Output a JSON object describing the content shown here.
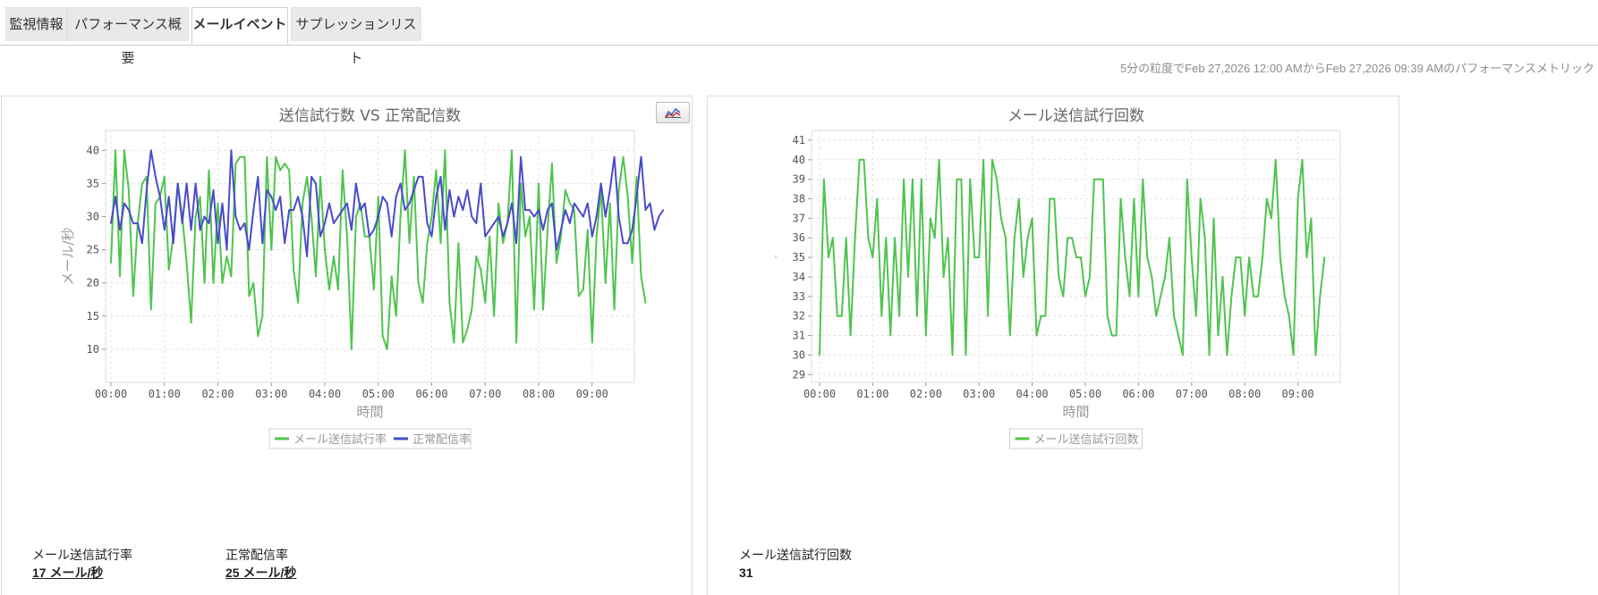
{
  "tabs": [
    {
      "label": "監視情報",
      "active": false
    },
    {
      "label": "パフォーマンス概要",
      "active": false
    },
    {
      "label": "メールイベント",
      "active": true
    },
    {
      "label": "サプレッションリスト",
      "active": false
    }
  ],
  "subtitle": "5分の粒度でFeb 27,2026 12:00 AMからFeb 27,2026 09:39 AMのパフォーマンスメトリック",
  "colors": {
    "green": "#4fc44f",
    "blue": "#4a4acc",
    "accent_text": "#8d8d8d"
  },
  "left_panel": {
    "chart_button_icon": "area-chart-icon",
    "metrics": [
      {
        "label": "メール送信試行率",
        "value": "17 メール/秒"
      },
      {
        "label": "正常配信率",
        "value": "25 メール/秒"
      }
    ]
  },
  "right_panel": {
    "metrics": [
      {
        "label": "メール送信試行回数",
        "value": "31"
      }
    ]
  },
  "chart_data": [
    {
      "type": "line",
      "title": "送信試行数 VS 正常配信数",
      "xlabel": "時間",
      "ylabel": "メール/秒",
      "ylim": [
        5,
        43
      ],
      "yticks": [
        10,
        15,
        20,
        25,
        30,
        35,
        40
      ],
      "xticks": [
        "00:00",
        "01:00",
        "02:00",
        "03:00",
        "04:00",
        "05:00",
        "06:00",
        "07:00",
        "08:00",
        "09:00"
      ],
      "x_interval_minutes": 5,
      "grid": true,
      "legend_position": "bottom-center",
      "series": [
        {
          "name": "メール送信試行率",
          "color": "#4fc44f",
          "values": [
            23,
            40,
            21,
            40,
            34,
            18,
            29,
            35,
            36,
            16,
            32,
            33,
            36,
            22,
            27,
            35,
            30,
            23,
            14,
            30,
            33,
            20,
            37,
            20,
            32,
            20,
            24,
            21,
            38,
            39,
            39,
            18,
            20,
            12,
            15,
            39,
            25,
            39,
            37,
            38,
            37,
            22,
            17,
            32,
            36,
            30,
            21,
            36,
            25,
            19,
            24,
            19,
            37,
            27,
            10,
            30,
            32,
            27,
            27,
            19,
            33,
            12,
            10,
            21,
            15,
            30,
            40,
            26,
            36,
            20,
            17,
            26,
            30,
            37,
            26,
            40,
            17,
            11,
            26,
            11,
            13,
            16,
            24,
            22,
            17,
            27,
            15,
            32,
            26,
            29,
            40,
            11,
            35,
            27,
            30,
            16,
            35,
            16,
            28,
            38,
            23,
            27,
            34,
            32,
            31,
            18,
            19,
            28,
            11,
            27,
            34,
            20,
            32,
            16,
            34,
            39,
            33,
            23,
            36,
            21,
            17
          ]
        },
        {
          "name": "正常配信率",
          "color": "#4a4acc",
          "values": [
            29,
            33,
            28,
            32,
            31,
            29,
            29,
            26,
            34,
            40,
            36,
            33,
            28,
            33,
            26,
            35,
            29,
            35,
            28,
            35,
            28,
            30,
            29,
            34,
            26,
            32,
            25,
            40,
            30,
            28,
            29,
            25,
            31,
            36,
            26,
            34,
            33,
            31,
            33,
            26,
            31,
            31,
            33,
            30,
            24,
            36,
            35,
            27,
            29,
            32,
            29,
            30,
            31,
            32,
            28,
            35,
            31,
            32,
            27,
            28,
            30,
            33,
            32,
            27,
            33,
            35,
            31,
            32,
            34,
            36,
            36,
            29,
            27,
            33,
            36,
            28,
            34,
            30,
            33,
            31,
            34,
            30,
            29,
            35,
            27,
            28,
            29,
            30,
            27,
            29,
            32,
            26,
            39,
            31,
            31,
            30,
            31,
            28,
            31,
            32,
            25,
            28,
            31,
            29,
            32,
            31,
            30,
            32,
            27,
            30,
            35,
            30,
            34,
            39,
            30,
            26,
            26,
            28,
            33,
            39,
            31,
            32,
            28,
            30,
            31
          ]
        }
      ]
    },
    {
      "type": "line",
      "title": "メール送信試行回数",
      "xlabel": "時間",
      "ylabel": "-",
      "ylim": [
        28.6,
        41.5
      ],
      "yticks": [
        29,
        30,
        31,
        32,
        33,
        34,
        35,
        36,
        37,
        38,
        39,
        40,
        41
      ],
      "xticks": [
        "00:00",
        "01:00",
        "02:00",
        "03:00",
        "04:00",
        "05:00",
        "06:00",
        "07:00",
        "08:00",
        "09:00"
      ],
      "x_interval_minutes": 5,
      "grid": true,
      "legend_position": "bottom-center",
      "series": [
        {
          "name": "メール送信試行回数",
          "color": "#4fc44f",
          "values": [
            30,
            39,
            35,
            36,
            32,
            32,
            36,
            31,
            36,
            40,
            40,
            36,
            35,
            38,
            32,
            36,
            31,
            36,
            32,
            39,
            34,
            39,
            32,
            39,
            31,
            37,
            36,
            40,
            34,
            36,
            30,
            39,
            39,
            30,
            39,
            35,
            35,
            40,
            32,
            40,
            39,
            37,
            36,
            31,
            36,
            38,
            34,
            36,
            37,
            31,
            32,
            32,
            38,
            38,
            34,
            33,
            36,
            36,
            35,
            35,
            33,
            34,
            39,
            39,
            39,
            32,
            31,
            31,
            38,
            35,
            33,
            38,
            33,
            39,
            35,
            34,
            32,
            33,
            34,
            36,
            32,
            31,
            30,
            39,
            35,
            32,
            38,
            36,
            30,
            37,
            31,
            34,
            30,
            33,
            35,
            35,
            32,
            35,
            33,
            33,
            35,
            38,
            37,
            40,
            35,
            33,
            32,
            30,
            38,
            40,
            35,
            37,
            30,
            33,
            35
          ]
        }
      ]
    }
  ]
}
